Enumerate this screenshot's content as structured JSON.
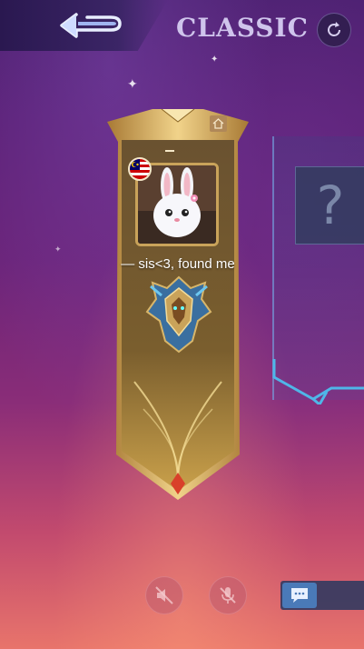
{
  "header": {
    "mode_title": "CLASSIC",
    "back_icon": "back-arrow-icon",
    "refresh_icon": "refresh-icon"
  },
  "player_card": {
    "name": "— sis<3, found me",
    "flag": "malaysia-flag",
    "avatar": "bunny-avatar",
    "rank_emblem": "rank-emblem",
    "banner_color": "#c9a35a"
  },
  "empty_slot": {
    "placeholder": "?"
  },
  "controls": {
    "speaker_icon": "speaker-muted-icon",
    "mic_icon": "mic-muted-icon",
    "chat_icon": "chat-icon"
  }
}
